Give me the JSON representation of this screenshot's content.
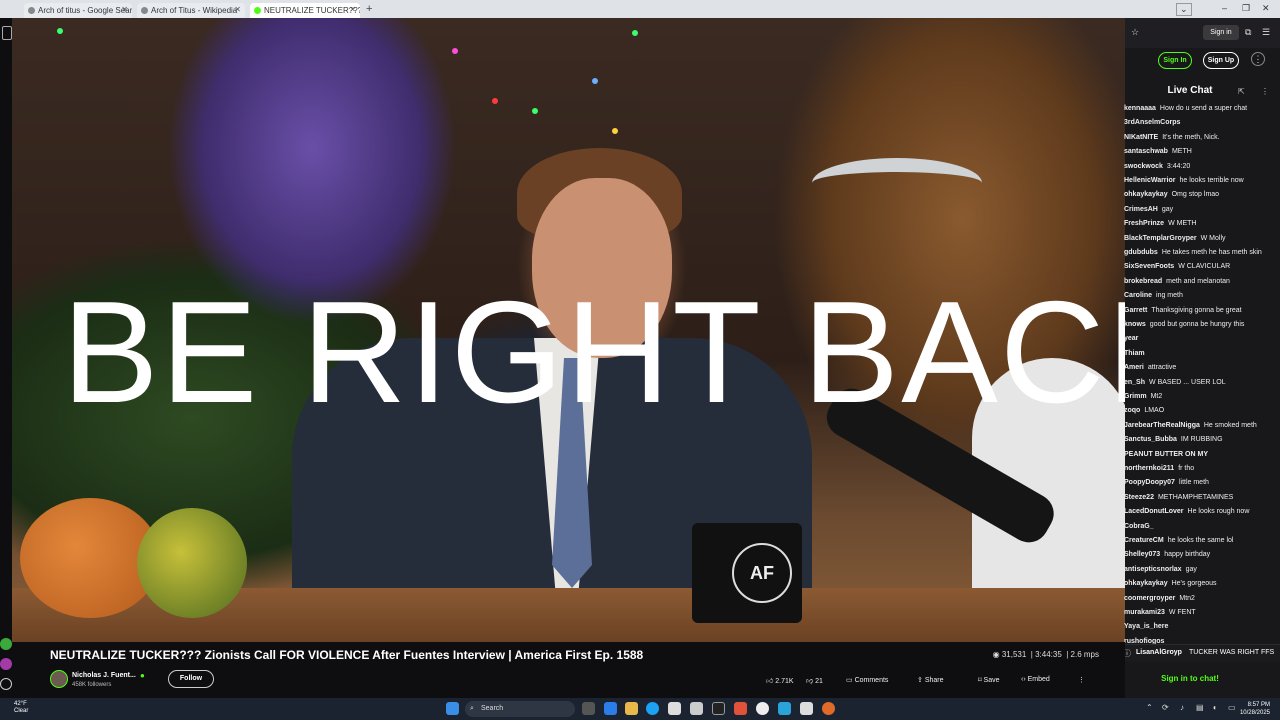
{
  "browser": {
    "tabs": [
      {
        "title": "Arch of titus - Google Search"
      },
      {
        "title": "Arch of Titus - Wikipedia"
      },
      {
        "title": "NEUTRALIZE TUCKER??? Z... PICTURE-IN-PICTURE"
      }
    ],
    "new_tab": "+"
  },
  "video": {
    "overlay_text": "BE RIGHT BACK",
    "mug_logo": "AF"
  },
  "chat": {
    "signin_chip": "Sign in",
    "signin_button": "Sign In",
    "signup_button": "Sign Up",
    "title": "Live Chat",
    "messages": [
      {
        "user": "kennaaaa",
        "text": "How do u send a super chat"
      },
      {
        "user": "3rdAnselmCorps",
        "text": ""
      },
      {
        "user": "NIKatNITE",
        "text": "It's the meth, Nick."
      },
      {
        "user": "santaschwab",
        "text": "METH"
      },
      {
        "user": "swockwock",
        "text": "3:44:20"
      },
      {
        "user": "HellenicWarrior",
        "text": "he looks terrible now"
      },
      {
        "user": "ohkaykaykay",
        "text": "Omg stop lmao"
      },
      {
        "user": "CrimesAH",
        "text": "gay"
      },
      {
        "user": "FreshPrinze",
        "text": "W METH"
      },
      {
        "user": "BlackTemplarGroyper",
        "text": "W Molly"
      },
      {
        "user": "gdubdubs",
        "text": "He takes meth he has meth skin"
      },
      {
        "user": "SixSevenFoots",
        "text": "W CLAVICULAR"
      },
      {
        "user": "brokebread",
        "text": "meth and melanotan"
      },
      {
        "user": "Caroline",
        "text": "ing meth"
      },
      {
        "user": "Garrett",
        "text": "Thanksgiving gonna be great"
      },
      {
        "user": "knows",
        "text": "good but gonna be hungry this"
      },
      {
        "user": "year",
        "text": ""
      },
      {
        "user": "Thiam",
        "text": ""
      },
      {
        "user": "Ameri",
        "text": "attractive"
      },
      {
        "user": "en_Sh",
        "text": "W BASED ... USER LOL"
      },
      {
        "user": "Grimm",
        "text": "Mt2"
      },
      {
        "user": "zoqo",
        "text": "LMAO"
      },
      {
        "user": "JarebearTheRealNigga",
        "text": "He smoked meth"
      },
      {
        "user": "Sanctus_Bubba",
        "text": "IM RUBBING"
      },
      {
        "user": "PEANUT BUTTER ON MY",
        "text": ""
      },
      {
        "user": "northernkoi211",
        "text": "fr tho"
      },
      {
        "user": "PoopyDoopy07",
        "text": "little meth"
      },
      {
        "user": "Steeze22",
        "text": "METHAMPHETAMINES"
      },
      {
        "user": "LacedDonutLover",
        "text": "He looks rough now"
      },
      {
        "user": "CobraG_",
        "text": ""
      },
      {
        "user": "CreatureCM",
        "text": "he looks the same lol"
      },
      {
        "user": "Shelley073",
        "text": "happy birthday"
      },
      {
        "user": "antisepticsnorlax",
        "text": "gay"
      },
      {
        "user": "ohkaykaykay",
        "text": "He's gorgeous"
      },
      {
        "user": "coomergroyper",
        "text": "Mtn2"
      },
      {
        "user": "murakami23",
        "text": "W FENT"
      },
      {
        "user": "Yaya_is_here",
        "text": ""
      },
      {
        "user": "rushofiogos",
        "text": ""
      }
    ],
    "last_message": {
      "user": "LisanAlGroyp",
      "text": "TUCKER WAS RIGHT FFS"
    },
    "signin_prompt": "Sign in to chat!"
  },
  "stream": {
    "title": "NEUTRALIZE TUCKER??? Zionists Call FOR VIOLENCE After Fuentes Interview | America First Ep. 1588",
    "viewers": "31,531",
    "duration": "3:44:35",
    "bitrate": "2.6 mps",
    "channel": "Nicholas J. Fuent...",
    "followers": "458K followers",
    "follow_label": "Follow",
    "likes": "2.71K",
    "dislikes": "21",
    "comments_label": "Comments",
    "share_label": "Share",
    "save_label": "Save",
    "embed_label": "Embed"
  },
  "taskbar": {
    "weather_temp": "42°F",
    "weather_desc": "Clear",
    "search_label": "Search",
    "time": "8:57 PM",
    "date": "10/28/2025"
  },
  "colors": {
    "accent": "#53fc18",
    "chat_bg": "#18181b",
    "page_bg": "#0e0e10"
  }
}
